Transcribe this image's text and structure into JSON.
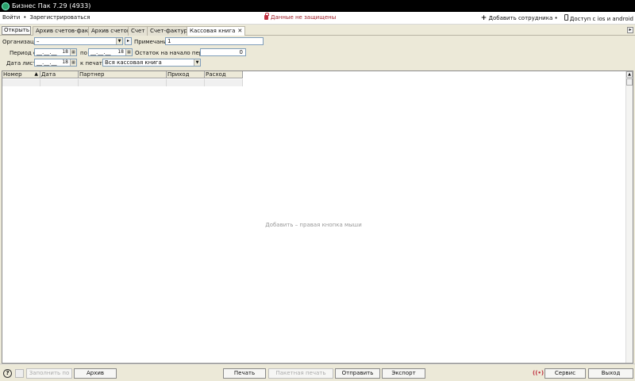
{
  "window": {
    "title": "Бизнес Пак 7.29 (4933)"
  },
  "menu": {
    "login": "Войти",
    "bullet": "•",
    "register": "Зарегистрироваться",
    "warning": "Данные не защищены",
    "add_employee": "Добавить сотрудника",
    "add_employee_bullet": "•",
    "mobile_access": "Доступ с ios и android"
  },
  "tabs": {
    "open_label": "Открыть",
    "items": [
      {
        "label": "Архив счетов-фактур"
      },
      {
        "label": "Архив счетов"
      },
      {
        "label": "Счет"
      },
      {
        "label": "Счет-фактура"
      },
      {
        "label": "Кассовая книга"
      }
    ],
    "close_glyph": "✕"
  },
  "form": {
    "organization_label": "Организация",
    "organization_value": "–",
    "note_label": "Примечание",
    "note_value": "1",
    "period_from_label": "Период с",
    "period_from_value": "__.__.__",
    "period_from_year": "18",
    "period_to_label": "по",
    "period_to_value": "__.__.__",
    "period_to_year": "18",
    "balance_label": "Остаток на начало периода",
    "balance_value": "0",
    "sheet_date_label": "Дата листа",
    "sheet_date_value": "__.__.__",
    "sheet_date_year": "18",
    "print_label": "к печати",
    "print_value": "Вся кассовая книга"
  },
  "table": {
    "columns": [
      "Номер",
      "Дата",
      "Партнер",
      "Приход",
      "Расход"
    ],
    "sort_glyph": "▲",
    "empty_hint": "Добавить – правая кнопка мыши"
  },
  "bottom": {
    "fill_button": "Заполнить по",
    "archive_button": "Архив",
    "print_button": "Печать",
    "batch_print_button": "Пакетная печать",
    "send_button": "Отправить",
    "export_button": "Экспорт",
    "service_button": "Сервис",
    "exit_button": "Выход",
    "help_glyph": "?",
    "rss_glyph": "((•))"
  }
}
